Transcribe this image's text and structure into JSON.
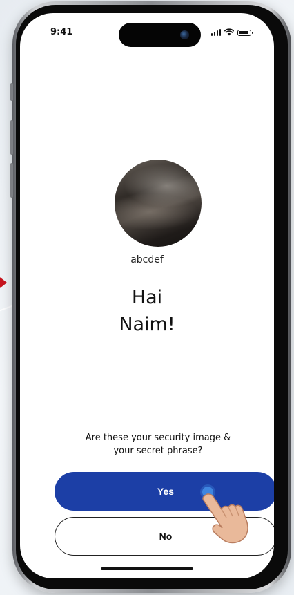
{
  "status_bar": {
    "time": "9:41"
  },
  "security": {
    "phrase": "abcdef"
  },
  "greeting": {
    "line1": "Hai",
    "line2": "Naim!"
  },
  "prompt": {
    "line1": "Are these your security image &",
    "line2": "your secret phrase?"
  },
  "actions": {
    "yes_label": "Yes",
    "no_label": "No"
  },
  "colors": {
    "primary": "#1c3fa6",
    "arrow": "#c8141e",
    "tap": "#3f86e0"
  },
  "icons": [
    "signal-icon",
    "wifi-icon",
    "battery-icon",
    "hand-pointer-icon"
  ]
}
